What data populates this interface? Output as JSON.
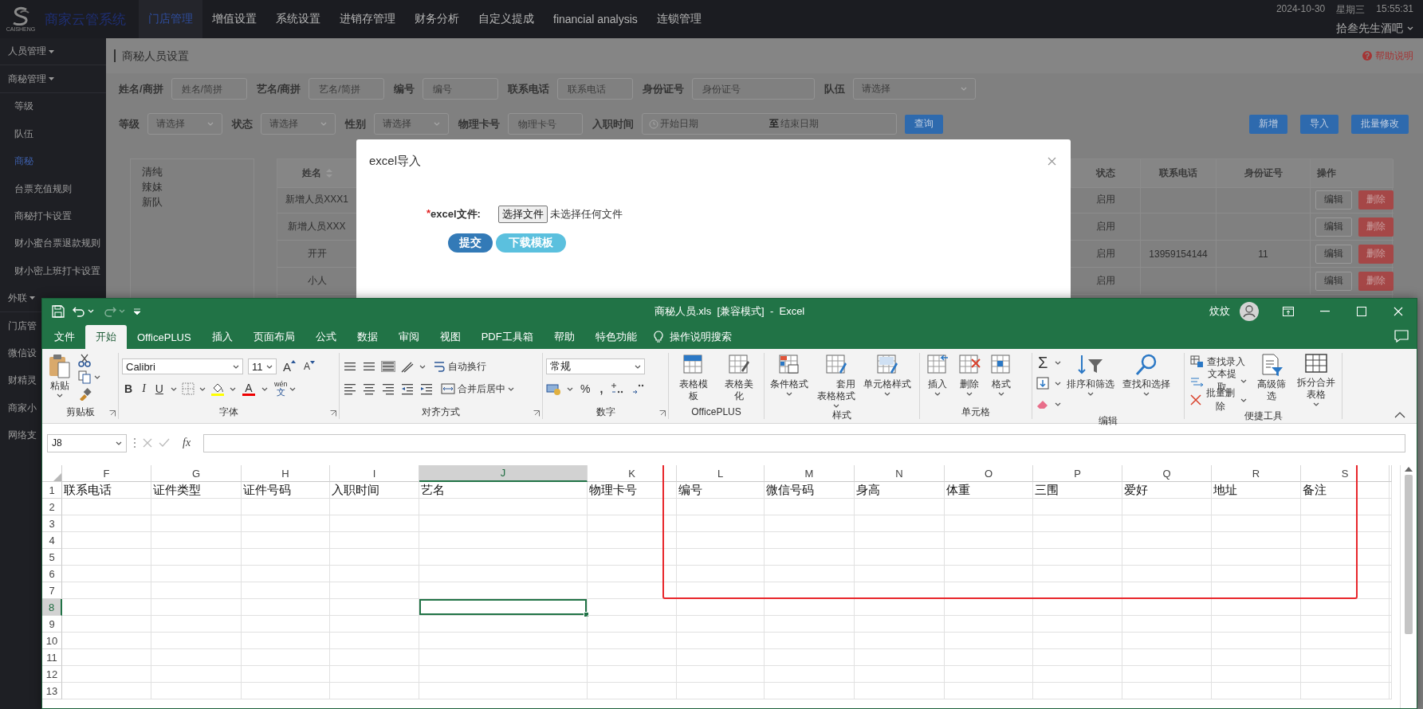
{
  "top_bar": {
    "logo_text": "CAISHENG",
    "brand": "商家云管系统",
    "nav": [
      {
        "label": "门店管理",
        "selected": true
      },
      {
        "label": "增值设置",
        "selected": false
      },
      {
        "label": "系统设置",
        "selected": false
      },
      {
        "label": "进销存管理",
        "selected": false
      },
      {
        "label": "财务分析",
        "selected": false
      },
      {
        "label": "自定义提成",
        "selected": false
      },
      {
        "label": "financial analysis",
        "selected": false
      },
      {
        "label": "连锁管理",
        "selected": false
      }
    ],
    "date": "2024-10-30",
    "weekday": "星期三",
    "time": "15:55:31",
    "user": "拾叁先生酒吧"
  },
  "sidebar": {
    "items": [
      {
        "label": "人员管理",
        "kind": "menu"
      },
      {
        "label": "商秘管理",
        "kind": "menu",
        "children": [
          {
            "label": "等级",
            "selected": false
          },
          {
            "label": "队伍",
            "selected": false
          },
          {
            "label": "商秘",
            "selected": true
          },
          {
            "label": "台票充值规则",
            "selected": false
          },
          {
            "label": "商秘打卡设置",
            "selected": false
          },
          {
            "label": "财小蜜台票退款规则",
            "selected": false
          },
          {
            "label": "财小密上班打卡设置",
            "selected": false
          }
        ]
      },
      {
        "label": "外联",
        "kind": "menu"
      },
      {
        "label": "门店管",
        "kind": "link"
      },
      {
        "label": "微信设",
        "kind": "link"
      },
      {
        "label": "财精灵",
        "kind": "link"
      },
      {
        "label": "商家小",
        "kind": "link"
      },
      {
        "label": "网络支",
        "kind": "link"
      }
    ]
  },
  "page": {
    "title": "商秘人员设置",
    "help": "帮助说明",
    "filters": [
      [
        {
          "label": "姓名/商拼",
          "kind": "text",
          "placeholder": "姓名/简拼"
        },
        {
          "label": "艺名/商拼",
          "kind": "text",
          "placeholder": "艺名/简拼"
        },
        {
          "label": "编号",
          "kind": "text",
          "placeholder": "编号"
        },
        {
          "label": "联系电话",
          "kind": "text",
          "placeholder": "联系电话"
        },
        {
          "label": "身份证号",
          "kind": "text",
          "placeholder": "身份证号"
        },
        {
          "label": "队伍",
          "kind": "select",
          "placeholder": "请选择"
        }
      ],
      [
        {
          "label": "等级",
          "kind": "select",
          "placeholder": "请选择"
        },
        {
          "label": "状态",
          "kind": "select",
          "placeholder": "请选择"
        },
        {
          "label": "性别",
          "kind": "select",
          "placeholder": "请选择"
        },
        {
          "label": "物理卡号",
          "kind": "text",
          "placeholder": "物理卡号"
        },
        {
          "label": "入职时间",
          "kind": "daterange",
          "start": "开始日期",
          "separator": "至",
          "end": "结束日期"
        }
      ]
    ],
    "query_button": "查询",
    "actions": [
      "新增",
      "导入",
      "批量修改"
    ],
    "teams": [
      "清纯",
      "辣妹",
      "新队"
    ],
    "table": {
      "columns": [
        {
          "label": "姓名",
          "sortable": true
        },
        {
          "label": "状态",
          "sortable": false
        },
        {
          "label": "联系电话",
          "sortable": false
        },
        {
          "label": "身份证号",
          "sortable": false
        },
        {
          "label": "操作",
          "sortable": false
        }
      ],
      "rows": [
        {
          "name": "新增人员XXX1",
          "status": "启用",
          "actions": [
            "编辑",
            "删除"
          ]
        },
        {
          "name": "新增人员XXX",
          "status": "启用",
          "actions": [
            "编辑",
            "删除"
          ]
        },
        {
          "name": "开开",
          "status": "启用",
          "phone": "13959154144",
          "id_number": "11",
          "actions": [
            "编辑",
            "删除"
          ]
        },
        {
          "name": "小人",
          "status": "启用",
          "actions": [
            "编辑",
            "删除"
          ]
        }
      ]
    }
  },
  "modal": {
    "title": "excel导入",
    "required_mark": "*",
    "field_label": "excel文件:",
    "file_button": "选择文件",
    "file_status": "未选择任何文件",
    "submit": "提交",
    "download": "下载模板"
  },
  "excel": {
    "title": "商秘人员.xls  [兼容模式]  -  Excel",
    "user": "炆炆",
    "redo": {
      "disabled": true
    },
    "tabs": [
      {
        "label": "文件",
        "selected": false
      },
      {
        "label": "开始",
        "selected": true
      },
      {
        "label": "OfficePLUS",
        "selected": false
      },
      {
        "label": "插入",
        "selected": false
      },
      {
        "label": "页面布局",
        "selected": false
      },
      {
        "label": "公式",
        "selected": false
      },
      {
        "label": "数据",
        "selected": false
      },
      {
        "label": "审阅",
        "selected": false
      },
      {
        "label": "视图",
        "selected": false
      },
      {
        "label": "PDF工具箱",
        "selected": false
      },
      {
        "label": "帮助",
        "selected": false
      },
      {
        "label": "特色功能",
        "selected": false
      }
    ],
    "search": "操作说明搜索",
    "ribbon": {
      "groups": [
        {
          "label": "剪贴板",
          "paste": "粘贴"
        },
        {
          "label": "字体",
          "font": "Calibri",
          "size": "11",
          "grow": "A",
          "shrink": "A",
          "bold": "B",
          "italic": "I",
          "underline": "U",
          "font_color": "A",
          "phonetic_top": "wén",
          "phonetic_bottom": "文"
        },
        {
          "label": "对齐方式",
          "vertical_align": [
            {
              "selected": false
            },
            {
              "selected": false
            },
            {
              "selected": true
            }
          ],
          "wrap": "自动换行",
          "merge": "合并后居中"
        },
        {
          "label": "数字",
          "format": "常规",
          "percent": "%",
          "comma": ","
        },
        {
          "label": "OfficePLUS",
          "buttons": [
            "表格模板",
            "表格美化"
          ]
        },
        {
          "label": "样式",
          "buttons": [
            "条件格式",
            "套用表格格式",
            "单元格样式"
          ]
        },
        {
          "label": "单元格",
          "buttons": [
            "插入",
            "删除",
            "格式"
          ]
        },
        {
          "label": "编辑",
          "sum": "Σ",
          "buttons": [
            "排序和筛选",
            "查找和选择"
          ]
        },
        {
          "label": "便捷工具",
          "small": [
            "查找录入",
            "文本提取",
            "批量删除"
          ],
          "buttons": [
            "高级筛选",
            "拆分合并表格"
          ]
        }
      ]
    },
    "name_box": "J8",
    "function_label": "fx",
    "sheet": {
      "columns": [
        {
          "label": "F",
          "selected": false
        },
        {
          "label": "G",
          "selected": false
        },
        {
          "label": "H",
          "selected": false
        },
        {
          "label": "I",
          "selected": false
        },
        {
          "label": "J",
          "selected": true
        },
        {
          "label": "K",
          "selected": false
        },
        {
          "label": "L",
          "selected": false
        },
        {
          "label": "M",
          "selected": false
        },
        {
          "label": "N",
          "selected": false
        },
        {
          "label": "O",
          "selected": false
        },
        {
          "label": "P",
          "selected": false
        },
        {
          "label": "Q",
          "selected": false
        },
        {
          "label": "R",
          "selected": false
        },
        {
          "label": "S",
          "selected": false
        }
      ],
      "rows": [
        {
          "label": "1",
          "selected": false,
          "cells": [
            "联系电话",
            "证件类型",
            "证件号码",
            "入职时间",
            "艺名",
            "物理卡号",
            "编号",
            "微信号码",
            "身高",
            "体重",
            "三围",
            "爱好",
            "地址",
            "备注"
          ]
        },
        {
          "label": "2",
          "selected": false
        },
        {
          "label": "3",
          "selected": false
        },
        {
          "label": "4",
          "selected": false
        },
        {
          "label": "5",
          "selected": false
        },
        {
          "label": "6",
          "selected": false
        },
        {
          "label": "7",
          "selected": false
        },
        {
          "label": "8",
          "selected": true
        },
        {
          "label": "9",
          "selected": false
        },
        {
          "label": "10",
          "selected": false
        },
        {
          "label": "11",
          "selected": false
        },
        {
          "label": "12",
          "selected": false
        },
        {
          "label": "13",
          "selected": false
        }
      ],
      "annotation": {
        "kind": "frame",
        "color": "#e8262b"
      }
    }
  }
}
